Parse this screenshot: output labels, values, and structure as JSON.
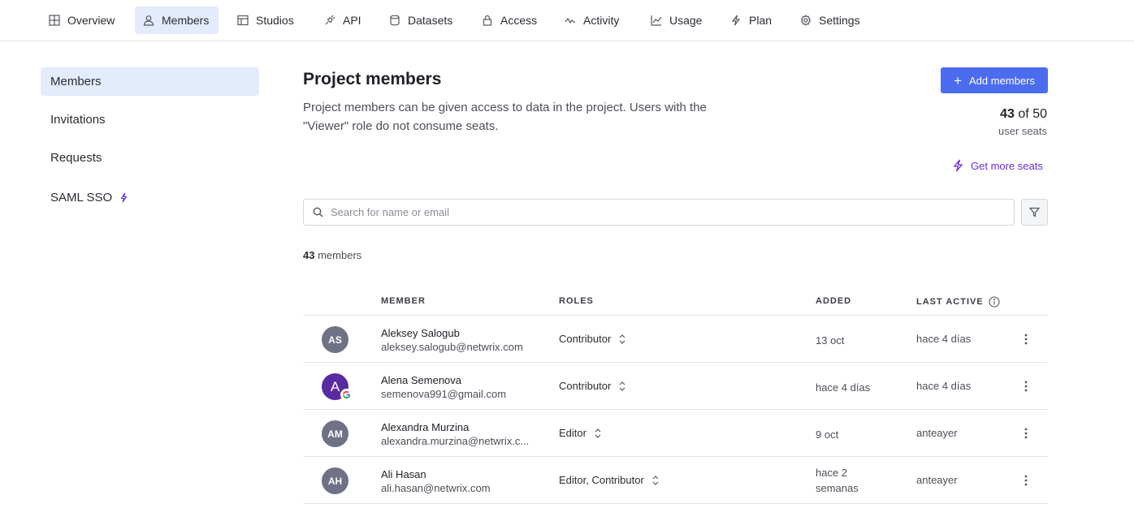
{
  "nav": {
    "tabs": [
      {
        "label": "Overview",
        "icon": "grid-icon"
      },
      {
        "label": "Members",
        "icon": "users-icon",
        "active": true
      },
      {
        "label": "Studios",
        "icon": "table-icon"
      },
      {
        "label": "API",
        "icon": "plug-icon"
      },
      {
        "label": "Datasets",
        "icon": "database-icon"
      },
      {
        "label": "Access",
        "icon": "lock-icon"
      },
      {
        "label": "Activity",
        "icon": "activity-icon"
      },
      {
        "label": "Usage",
        "icon": "chart-icon"
      },
      {
        "label": "Plan",
        "icon": "bolt-icon"
      },
      {
        "label": "Settings",
        "icon": "gear-icon"
      }
    ]
  },
  "sidebar": {
    "items": [
      {
        "label": "Members",
        "active": true
      },
      {
        "label": "Invitations"
      },
      {
        "label": "Requests"
      },
      {
        "label": "SAML SSO",
        "icon": "bolt-icon"
      }
    ]
  },
  "main": {
    "title": "Project members",
    "description_line1": "Project members can be given access to data in the project. Users with the",
    "description_line2": "\"Viewer\" role do not consume seats.",
    "add_button": "Add members",
    "seats_used": "43",
    "seats_of": "of 50",
    "seats_label": "user seats",
    "get_more": "Get more seats",
    "search_placeholder": "Search for name or email",
    "count_number": "43",
    "count_label": "members"
  },
  "table": {
    "headers": {
      "member": "MEMBER",
      "roles": "ROLES",
      "added": "ADDED",
      "last_active": "LAST ACTIVE"
    },
    "rows": [
      {
        "initials": "AS",
        "name": "Aleksey Salogub",
        "email": "aleksey.salogub@netwrix.com",
        "roles": "Contributor",
        "added": "13 oct",
        "last_active": "hace 4 días"
      },
      {
        "initials": "A",
        "name": "Alena Semenova",
        "email": "semenova991@gmail.com",
        "roles": "Contributor",
        "added": "hace 4 días",
        "last_active": "hace 4 días"
      },
      {
        "initials": "AM",
        "name": "Alexandra Murzina",
        "email": "alexandra.murzina@netwrix.c...",
        "roles": "Editor",
        "added": "9 oct",
        "last_active": "anteayer"
      },
      {
        "initials": "AH",
        "name": "Ali Hasan",
        "email": "ali.hasan@netwrix.com",
        "roles": "Editor, Contributor",
        "added_line1": "hace 2",
        "added_line2": "semanas",
        "last_active": "anteayer"
      }
    ]
  },
  "colors": {
    "accent": "#4c6cf0",
    "active_bg": "#e3ebfc",
    "upsell": "#6c2bd9",
    "avatar_gray": "#6f7184",
    "avatar_purple": "#5a2aa3"
  }
}
